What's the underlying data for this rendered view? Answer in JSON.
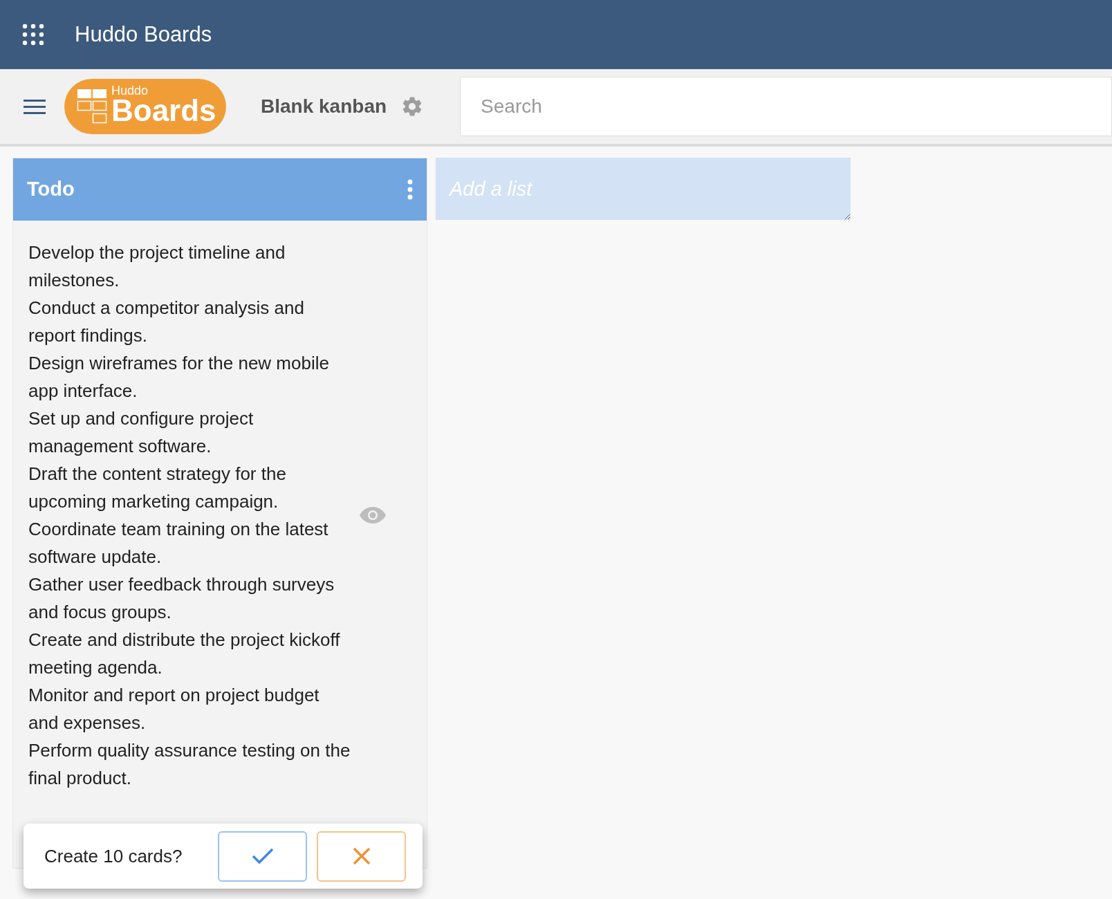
{
  "app_bar": {
    "title": "Huddo Boards"
  },
  "toolbar": {
    "logo": {
      "small": "Huddo",
      "large": "Boards"
    },
    "board_name": "Blank kanban",
    "search": {
      "placeholder": "Search"
    }
  },
  "lists": [
    {
      "title": "Todo",
      "draft_items": [
        "Develop the project timeline and milestones.",
        "Conduct a competitor analysis and report findings.",
        "Design wireframes for the new mobile app interface.",
        "Set up and configure project management software.",
        "Draft the content strategy for the upcoming marketing campaign.",
        "Coordinate team training on the latest software update.",
        "Gather user feedback through surveys and focus groups.",
        "Create and distribute the project kickoff meeting agenda.",
        "Monitor and report on project budget and expenses.",
        "Perform quality assurance testing on the final product."
      ]
    }
  ],
  "add_list": {
    "placeholder": "Add a list"
  },
  "confirm": {
    "message": "Create 10 cards?"
  }
}
